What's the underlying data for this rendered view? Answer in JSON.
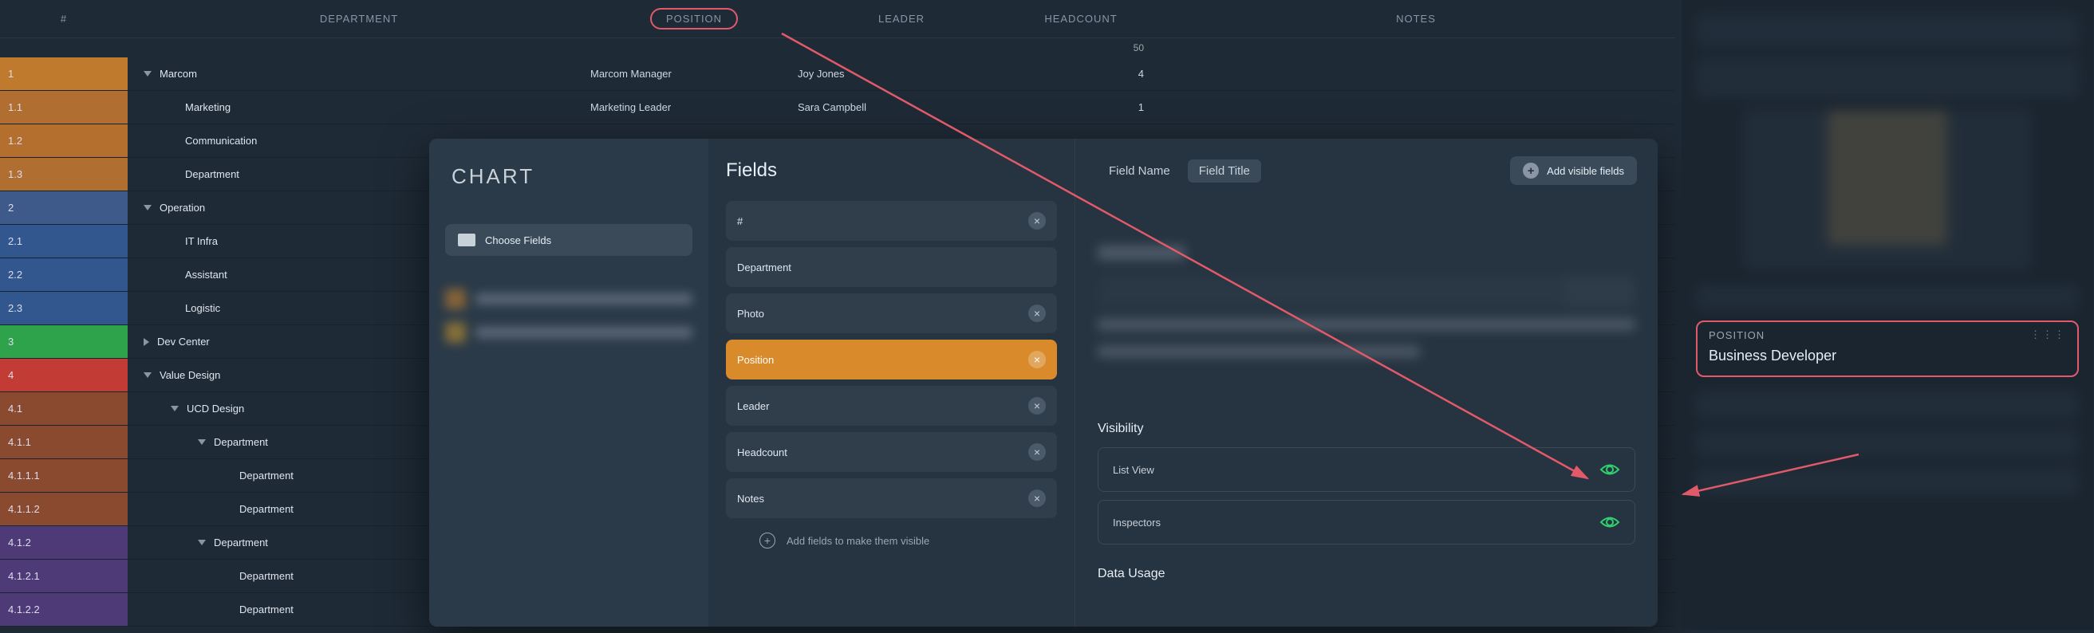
{
  "headers": {
    "num": "#",
    "department": "DEPARTMENT",
    "position": "POSITION",
    "leader": "LEADER",
    "headcount": "HEADCOUNT",
    "notes": "NOTES",
    "sum": "50"
  },
  "rows": [
    {
      "num": "1",
      "dept": "Marcom",
      "pos": "Marcom Manager",
      "leader": "Joy Jones",
      "head": "4",
      "indent": 0,
      "tri": "down",
      "numbg": "bg-amber1"
    },
    {
      "num": "1.1",
      "dept": "Marketing",
      "pos": "Marketing Leader",
      "leader": "Sara Campbell",
      "head": "1",
      "indent": 1,
      "tri": "",
      "numbg": "bg-amber2"
    },
    {
      "num": "1.2",
      "dept": "Communication",
      "indent": 1,
      "tri": "",
      "numbg": "bg-amber3"
    },
    {
      "num": "1.3",
      "dept": "Department",
      "indent": 1,
      "tri": "",
      "numbg": "bg-amber2"
    },
    {
      "num": "2",
      "dept": "Operation",
      "indent": 0,
      "tri": "down",
      "numbg": "bg-blue1"
    },
    {
      "num": "2.1",
      "dept": "IT Infra",
      "indent": 1,
      "tri": "",
      "numbg": "bg-blue2"
    },
    {
      "num": "2.2",
      "dept": "Assistant",
      "indent": 1,
      "tri": "",
      "numbg": "bg-blue2"
    },
    {
      "num": "2.3",
      "dept": "Logistic",
      "indent": 1,
      "tri": "",
      "numbg": "bg-blue2"
    },
    {
      "num": "3",
      "dept": "Dev Center",
      "indent": 0,
      "tri": "right",
      "numbg": "bg-green"
    },
    {
      "num": "4",
      "dept": "Value Design",
      "indent": 0,
      "tri": "down",
      "numbg": "bg-red"
    },
    {
      "num": "4.1",
      "dept": "UCD Design",
      "indent": 1,
      "tri": "down",
      "numbg": "bg-brown"
    },
    {
      "num": "4.1.1",
      "dept": "Department",
      "indent": 2,
      "tri": "down",
      "numbg": "bg-brown"
    },
    {
      "num": "4.1.1.1",
      "dept": "Department",
      "indent": 3,
      "tri": "",
      "numbg": "bg-brown"
    },
    {
      "num": "4.1.1.2",
      "dept": "Department",
      "indent": 3,
      "tri": "",
      "numbg": "bg-brown"
    },
    {
      "num": "4.1.2",
      "dept": "Department",
      "indent": 2,
      "tri": "down",
      "numbg": "bg-purple"
    },
    {
      "num": "4.1.2.1",
      "dept": "Department",
      "indent": 3,
      "tri": "",
      "numbg": "bg-purple"
    },
    {
      "num": "4.1.2.2",
      "dept": "Department",
      "indent": 3,
      "tri": "",
      "numbg": "bg-purple"
    }
  ],
  "dialog": {
    "chart_title": "CHART",
    "choose_fields": "Choose Fields",
    "fields_title": "Fields",
    "fields": [
      {
        "name": "#",
        "removable": true,
        "sel": false
      },
      {
        "name": "Department",
        "removable": false,
        "sel": false
      },
      {
        "name": "Photo",
        "removable": true,
        "sel": false
      },
      {
        "name": "Position",
        "removable": true,
        "sel": true
      },
      {
        "name": "Leader",
        "removable": true,
        "sel": false
      },
      {
        "name": "Headcount",
        "removable": true,
        "sel": false
      },
      {
        "name": "Notes",
        "removable": true,
        "sel": false
      }
    ],
    "add_hint": "Add fields to make them visible",
    "tabs": {
      "name": "Field Name",
      "title": "Field Title"
    },
    "add_visible": "Add visible fields",
    "visibility_title": "Visibility",
    "vis_items": [
      "List View",
      "Inspectors"
    ],
    "data_usage": "Data Usage"
  },
  "inspector": {
    "position_label": "POSITION",
    "position_value": "Business Developer"
  }
}
